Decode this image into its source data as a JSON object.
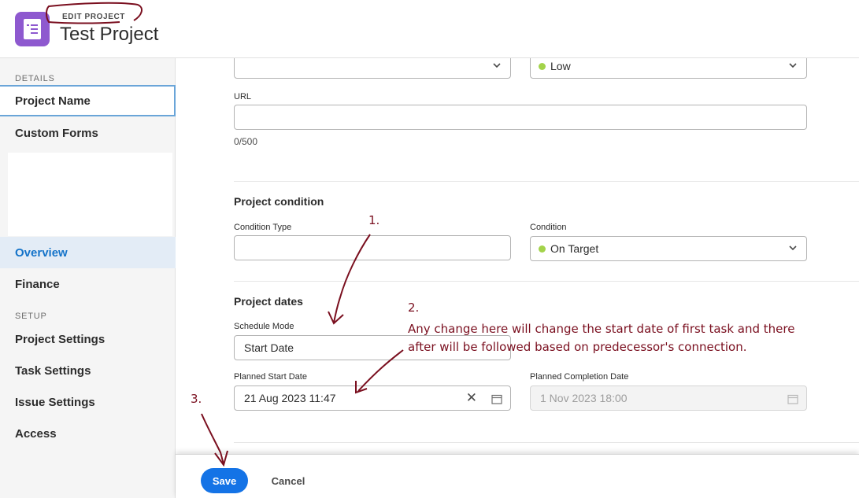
{
  "header": {
    "kicker": "EDIT PROJECT",
    "title": "Test Project"
  },
  "sidebar": {
    "details_label": "DETAILS",
    "setup_label": "SETUP",
    "items": [
      {
        "label": "Project Name"
      },
      {
        "label": "Custom Forms"
      },
      {
        "label": "Overview"
      },
      {
        "label": "Finance"
      },
      {
        "label": "Project Settings"
      },
      {
        "label": "Task Settings"
      },
      {
        "label": "Issue Settings"
      },
      {
        "label": "Access"
      }
    ]
  },
  "form": {
    "top_select_value": "",
    "priority_value": "Low",
    "url_label": "URL",
    "url_value": "",
    "url_counter": "0/500",
    "condition_section_title": "Project condition",
    "condition_type_label": "Condition Type",
    "condition_type_value": "",
    "condition_label": "Condition",
    "condition_value": "On Target",
    "dates_section_title": "Project dates",
    "schedule_mode_label": "Schedule Mode",
    "schedule_mode_value": "Start Date",
    "planned_start_label": "Planned Start Date",
    "planned_start_value": "21 Aug 2023 11:47",
    "planned_completion_label": "Planned Completion Date",
    "planned_completion_value": "1 Nov 2023 18:00",
    "clear_symbol": "✕"
  },
  "footer": {
    "save_label": "Save",
    "cancel_label": "Cancel"
  },
  "annotations": {
    "step1": "1.",
    "step2": "2.",
    "step3": "3.",
    "note_line1": "Any change here will change the start date of first task and there",
    "note_line2": "after will be followed based on predecessor's connection."
  },
  "colors": {
    "accent": "#1473e6",
    "active_nav": "#1473c9",
    "status_dot": "#a3d34a",
    "annotation": "#7a0f1f",
    "app_icon": "#8e59cf"
  }
}
